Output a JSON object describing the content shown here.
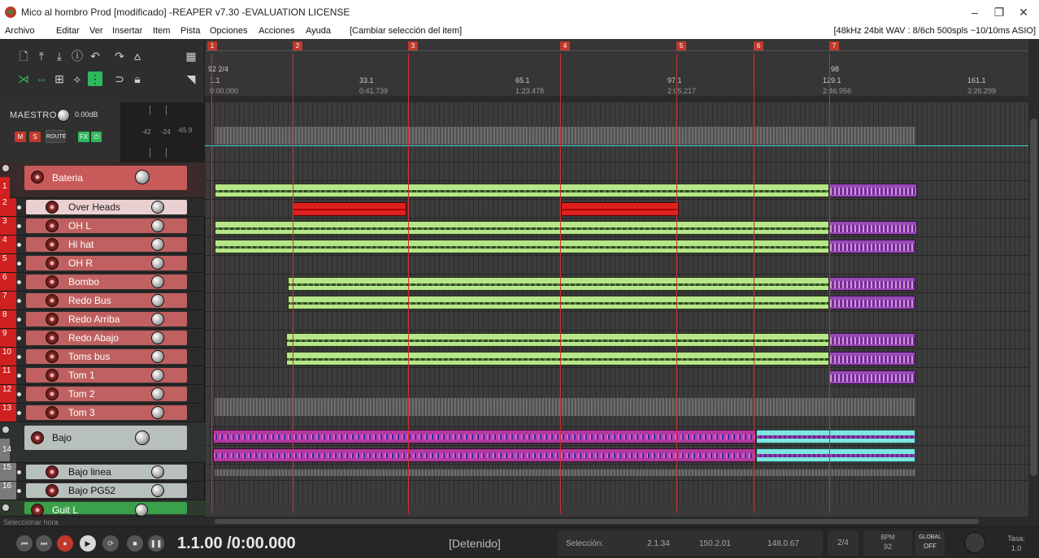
{
  "window": {
    "title": "Mico al hombro Prod [modificado] -REAPER v7.30 -EVALUATION LICENSE",
    "minimize": "–",
    "maximize": "❐",
    "close": "✕"
  },
  "menu": {
    "items": [
      "Archivo",
      "Editar",
      "Ver",
      "Insertar",
      "Item",
      "Pista",
      "Opciones",
      "Acciones",
      "Ayuda",
      "[Cambiar selección del item]"
    ],
    "status": "[48kHz 24bit WAV : 8/6ch 500spls ~10/10ms ASIO]"
  },
  "master": {
    "label": "MAESTRO",
    "volume": "0.00dB",
    "mute": "M",
    "solo": "S",
    "route": "ROUTE",
    "fx": "FX",
    "meter_scale": [
      "-42",
      "-24",
      "-65.9"
    ]
  },
  "tracks": [
    {
      "num": "1",
      "name": "Bateria",
      "color": "#c85a5a"
    },
    {
      "num": "2",
      "name": "Over Heads",
      "color": "#e8c8c8"
    },
    {
      "num": "3",
      "name": "OH L",
      "color": "#c06060"
    },
    {
      "num": "4",
      "name": "Hi hat",
      "color": "#c06060"
    },
    {
      "num": "5",
      "name": "OH R",
      "color": "#c06060"
    },
    {
      "num": "6",
      "name": "Bombo",
      "color": "#c06060"
    },
    {
      "num": "7",
      "name": "Redo Bus",
      "color": "#c06060"
    },
    {
      "num": "8",
      "name": "Redo Arriba",
      "color": "#c06060"
    },
    {
      "num": "9",
      "name": "Redo Abajo",
      "color": "#c06060"
    },
    {
      "num": "10",
      "name": "Toms bus",
      "color": "#c06060"
    },
    {
      "num": "11",
      "name": "Tom 1",
      "color": "#c06060"
    },
    {
      "num": "12",
      "name": "Tom 2",
      "color": "#c06060"
    },
    {
      "num": "13",
      "name": "Tom 3",
      "color": "#c06060"
    },
    {
      "num": "14",
      "name": "Bajo",
      "color": "#b8c0bc"
    },
    {
      "num": "15",
      "name": "Bajo linea",
      "color": "#b8c0bc"
    },
    {
      "num": "16",
      "name": "Bajo PG52",
      "color": "#b8c0bc"
    },
    {
      "num": "",
      "name": "Guit L",
      "color": "#3aa04a"
    }
  ],
  "ruler": {
    "markers": [
      "1",
      "2",
      "3",
      "4",
      "5",
      "6",
      "7"
    ],
    "tempo_start": "92 2/4",
    "tempo_marker": "98",
    "positions": [
      {
        "bar": "1.1",
        "time": "0:00.000"
      },
      {
        "bar": "33.1",
        "time": "0:41.739"
      },
      {
        "bar": "65.1",
        "time": "1:23.478"
      },
      {
        "bar": "97.1",
        "time": "2:05.217"
      },
      {
        "bar": "129.1",
        "time": "2:46.956"
      },
      {
        "bar": "161.1",
        "time": "3:26.299"
      }
    ]
  },
  "status_hint": "Seleccionar hora",
  "transport": {
    "time": "1.1.00 /0:00.000",
    "state": "[Detenido]",
    "selection_label": "Selección:",
    "sel_start": "2.1.34",
    "sel_end": "150.2.01",
    "sel_length": "148.0.67",
    "time_sig": "2/4",
    "bpm_label": "BPM",
    "bpm": "92",
    "global_label": "GLOBAL",
    "global_state": "OFF",
    "rate_label": "Tasa:",
    "rate": "1.0"
  },
  "colors": {
    "accent_green": "#2fb85c",
    "marker_red": "#d03030",
    "envelope_cyan": "#3ad0e0"
  }
}
